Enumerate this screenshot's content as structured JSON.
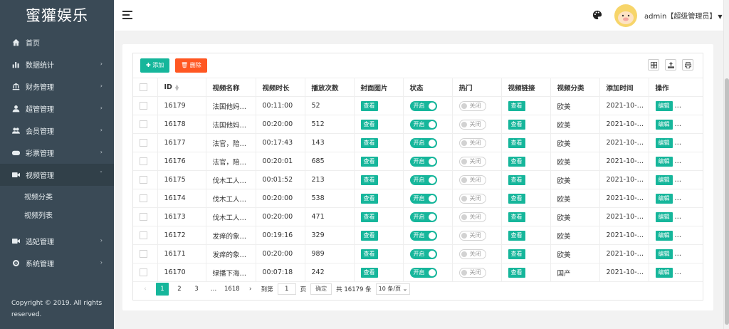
{
  "app": {
    "title": "蜜獾娱乐"
  },
  "sidebar": {
    "items": [
      {
        "label": "首页",
        "icon": "home-icon"
      },
      {
        "label": "数据统计",
        "icon": "bar-chart-icon"
      },
      {
        "label": "财务管理",
        "icon": "bank-icon"
      },
      {
        "label": "超管管理",
        "icon": "user-icon"
      },
      {
        "label": "会员管理",
        "icon": "users-icon"
      },
      {
        "label": "彩票管理",
        "icon": "gamepad-icon"
      },
      {
        "label": "视频管理",
        "icon": "video-icon"
      },
      {
        "label": "选妃管理",
        "icon": "video-icon"
      },
      {
        "label": "系统管理",
        "icon": "gear-icon"
      }
    ],
    "submenu": [
      "视频分类",
      "视频列表"
    ],
    "copyright": "Copyright © 2019. All rights reserved."
  },
  "header": {
    "user": "admin【超级管理员】"
  },
  "toolbar": {
    "add_label": "添加",
    "delete_label": "删除"
  },
  "table": {
    "columns": [
      "ID",
      "视频名称",
      "视频时长",
      "播放次数",
      "封面图片",
      "状态",
      "热门",
      "视频链接",
      "视频分类",
      "添加时间",
      "操作"
    ],
    "view_label": "查看",
    "on_label": "开启",
    "off_label": "关闭",
    "edit_label": "编辑",
    "rows": [
      {
        "id": "16179",
        "name": "法国他妈…",
        "duration": "00:11:00",
        "plays": "52",
        "category": "欧美",
        "time": "2021-10-…"
      },
      {
        "id": "16178",
        "name": "法国他妈…",
        "duration": "00:20:00",
        "plays": "512",
        "category": "欧美",
        "time": "2021-10-…"
      },
      {
        "id": "16177",
        "name": "法官，陪…",
        "duration": "00:17:43",
        "plays": "143",
        "category": "欧美",
        "time": "2021-10-…"
      },
      {
        "id": "16176",
        "name": "法官，陪…",
        "duration": "00:20:01",
        "plays": "685",
        "category": "欧美",
        "time": "2021-10-…"
      },
      {
        "id": "16175",
        "name": "伐木工人…",
        "duration": "00:01:52",
        "plays": "213",
        "category": "欧美",
        "time": "2021-10-…"
      },
      {
        "id": "16174",
        "name": "伐木工人…",
        "duration": "00:20:00",
        "plays": "538",
        "category": "欧美",
        "time": "2021-10-…"
      },
      {
        "id": "16173",
        "name": "伐木工人…",
        "duration": "00:20:00",
        "plays": "471",
        "category": "欧美",
        "time": "2021-10-…"
      },
      {
        "id": "16172",
        "name": "发痒的象…",
        "duration": "00:19:16",
        "plays": "329",
        "category": "欧美",
        "time": "2021-10-…"
      },
      {
        "id": "16171",
        "name": "发痒的象…",
        "duration": "00:20:00",
        "plays": "989",
        "category": "欧美",
        "time": "2021-10-…"
      },
      {
        "id": "16170",
        "name": "绿播下海…",
        "duration": "00:07:18",
        "plays": "242",
        "category": "国产",
        "time": "2021-10-…"
      }
    ]
  },
  "pagination": {
    "pages": [
      "1",
      "2",
      "3",
      "…",
      "1618"
    ],
    "goto_prefix": "到第",
    "goto_value": "1",
    "goto_suffix": "页",
    "confirm_label": "确定",
    "total": "共 16179 条",
    "page_size": "10 条/页"
  },
  "colors": {
    "accent": "#16b69b",
    "danger": "#ff5722",
    "sidebar": "#3a4a56"
  }
}
